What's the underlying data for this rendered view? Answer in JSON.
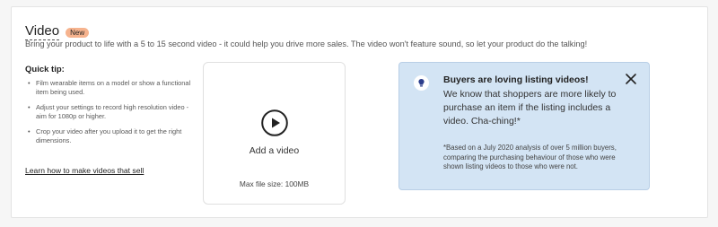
{
  "section": {
    "title": "Video",
    "badge": "New",
    "subtitle": "Bring your product to life with a 5 to 15 second video - it could help you drive more sales. The video won't feature sound, so let your product do the talking!"
  },
  "quick_tip": {
    "heading": "Quick tip:",
    "bullet": "•",
    "items": [
      "Film wearable items on a model or show a functional item being used.",
      "Adjust your settings to record high resolution video - aim for 1080p or higher.",
      "Crop your video after you upload it to get the right dimensions."
    ],
    "link": "Learn how to make videos that sell"
  },
  "upload": {
    "icon": "play-icon",
    "label": "Add a video",
    "max_size": "Max file size: 100MB"
  },
  "info": {
    "icon": "lightbulb-icon",
    "close_icon": "close-icon",
    "heading": "Buyers are loving listing videos!",
    "body": "We know that shoppers are more likely to purchase an item if the listing includes a video. Cha-ching!*",
    "footnote": "*Based on a July 2020 analysis of over 5 million buyers, comparing the purchasing behaviour of those who were shown listing videos to those who were not."
  },
  "colors": {
    "badge": "#f6b38e",
    "info_background": "#d3e4f4",
    "info_icon": "#2c3e8c"
  }
}
